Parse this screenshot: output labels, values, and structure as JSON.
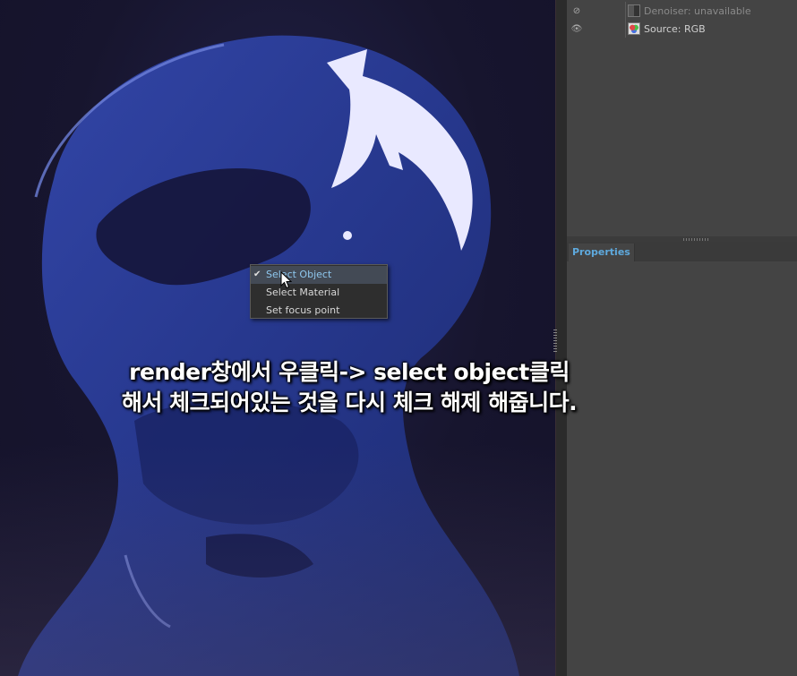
{
  "layers": [
    {
      "label": "Denoiser: unavailable",
      "visible": false,
      "icon": "denoiser-thumb"
    },
    {
      "label": "Source: RGB",
      "visible": true,
      "icon": "rgb-thumb"
    }
  ],
  "properties": {
    "tab_label": "Properties"
  },
  "context_menu": {
    "items": [
      {
        "label": "Select Object",
        "checked": true
      },
      {
        "label": "Select Material",
        "checked": false
      },
      {
        "label": "Set focus point",
        "checked": false
      }
    ],
    "check_glyph": "✔"
  },
  "caption": {
    "line1": "render창에서 우클릭-> select object클릭",
    "line2": "해서 체크되어있는 것을 다시 체크 해제 해줍니다."
  },
  "colors": {
    "render_bg": "#17152e",
    "figure": "#2a3b8f",
    "highlight": "#e8e8ff",
    "panel_bg": "#444444",
    "accent": "#5ea9dd"
  }
}
